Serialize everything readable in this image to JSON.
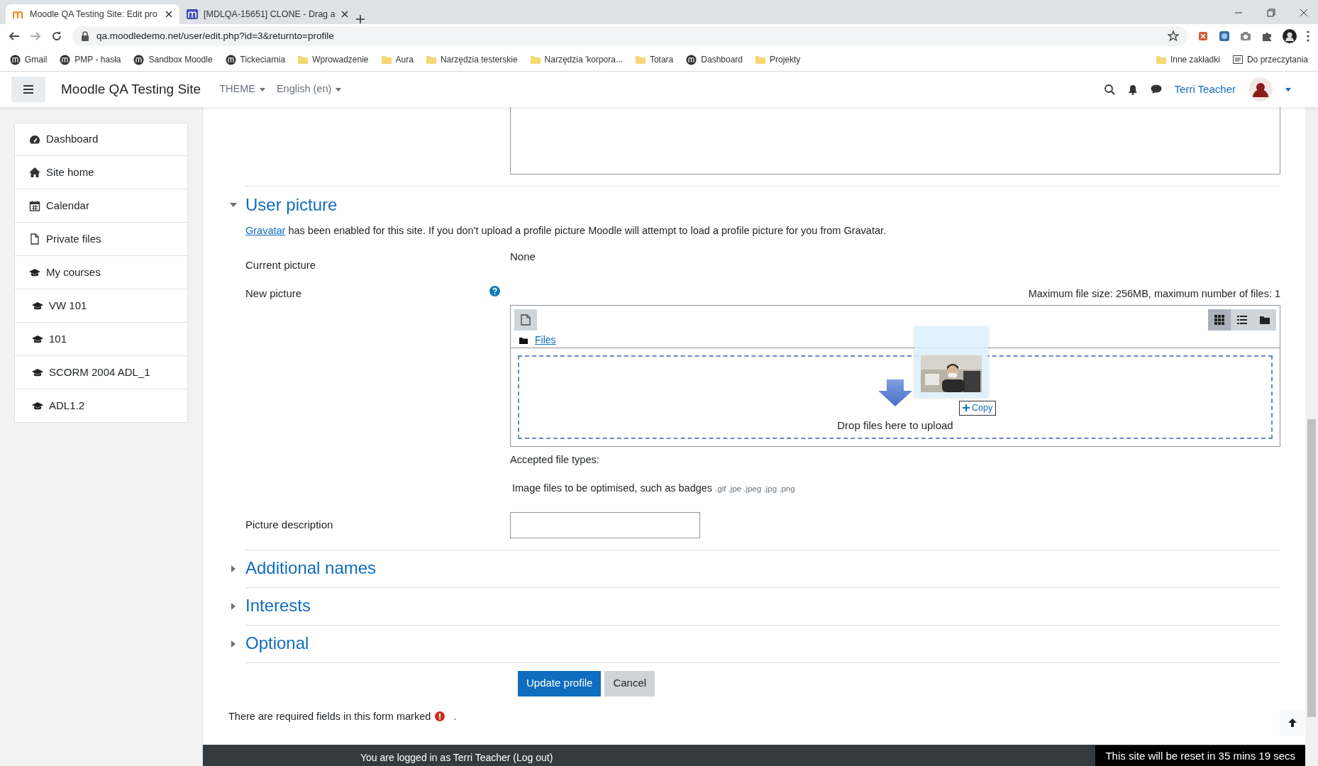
{
  "browser": {
    "tabs": [
      {
        "title": "Moodle QA Testing Site: Edit pro",
        "selected": true
      },
      {
        "title": "[MDLQA-15651] CLONE - Drag a",
        "selected": false
      }
    ],
    "url": "qa.moodledemo.net/user/edit.php?id=3&returnto=profile",
    "bookmarks": [
      {
        "label": "Gmail",
        "kind": "site"
      },
      {
        "label": "PMP - hasła",
        "kind": "site"
      },
      {
        "label": "Sandbox Moodle",
        "kind": "site"
      },
      {
        "label": "Tickeciarnia",
        "kind": "site"
      },
      {
        "label": "Wprowadzenie",
        "kind": "folder"
      },
      {
        "label": "Aura",
        "kind": "folder"
      },
      {
        "label": "Narzędzia testerskie",
        "kind": "folder"
      },
      {
        "label": "Narzędzia 'korpora...",
        "kind": "folder"
      },
      {
        "label": "Totara",
        "kind": "folder"
      },
      {
        "label": "Dashboard",
        "kind": "site"
      },
      {
        "label": "Projekty",
        "kind": "folder"
      }
    ],
    "other_bookmarks": [
      {
        "label": "Inne zakładki",
        "kind": "folder"
      },
      {
        "label": "Do przeczytania",
        "kind": "reading"
      }
    ]
  },
  "navbar": {
    "site_name": "Moodle QA Testing Site",
    "menus": [
      "THEME",
      "English (en)"
    ],
    "user": "Terri Teacher"
  },
  "sidebar": {
    "items": [
      {
        "label": "Dashboard",
        "kind": "dashboard"
      },
      {
        "label": "Site home",
        "kind": "home"
      },
      {
        "label": "Calendar",
        "kind": "calendar"
      },
      {
        "label": "Private files",
        "kind": "file"
      },
      {
        "label": "My courses",
        "kind": "courses"
      },
      {
        "label": "VW 101",
        "kind": "course"
      },
      {
        "label": "101",
        "kind": "course"
      },
      {
        "label": "SCORM 2004 ADL_1",
        "kind": "course"
      },
      {
        "label": "ADL1.2",
        "kind": "course"
      }
    ]
  },
  "form": {
    "sections": [
      {
        "title": "User picture",
        "expanded": true
      },
      {
        "title": "Additional names",
        "expanded": false
      },
      {
        "title": "Interests",
        "expanded": false
      },
      {
        "title": "Optional",
        "expanded": false
      }
    ],
    "gravatar_link": "Gravatar",
    "gravatar_note": "has been enabled for this site. If you don't upload a profile picture Moodle will attempt to load a profile picture for you from Gravatar.",
    "current_picture": {
      "label": "Current picture",
      "value": "None"
    },
    "new_picture": {
      "label": "New picture",
      "max_info": "Maximum file size: 256MB, maximum number of files: 1",
      "path": "Files",
      "view_modes": [
        {
          "kind": "icons",
          "selected": true
        },
        {
          "kind": "list",
          "selected": false
        },
        {
          "kind": "tree",
          "selected": false
        }
      ],
      "drop_text": "Drop files here to upload",
      "drag_badge": "Copy"
    },
    "accepted_label": "Accepted file types:",
    "accepted_desc": "Image files to be optimised, such as badges",
    "accepted_ext": ".gif .jpe .jpeg .jpg .png",
    "picture_description": {
      "label": "Picture description"
    },
    "buttons": [
      {
        "label": "Update profile",
        "kind": "primary"
      },
      {
        "label": "Cancel",
        "kind": "secondary"
      }
    ],
    "required_note": "There are required fields in this form marked",
    "required_note_end": "."
  },
  "footer": {
    "login_text": "You are logged in as Terri Teacher (Log out)",
    "reset_notice": "This site will be reset in 35 mins 19 secs"
  }
}
